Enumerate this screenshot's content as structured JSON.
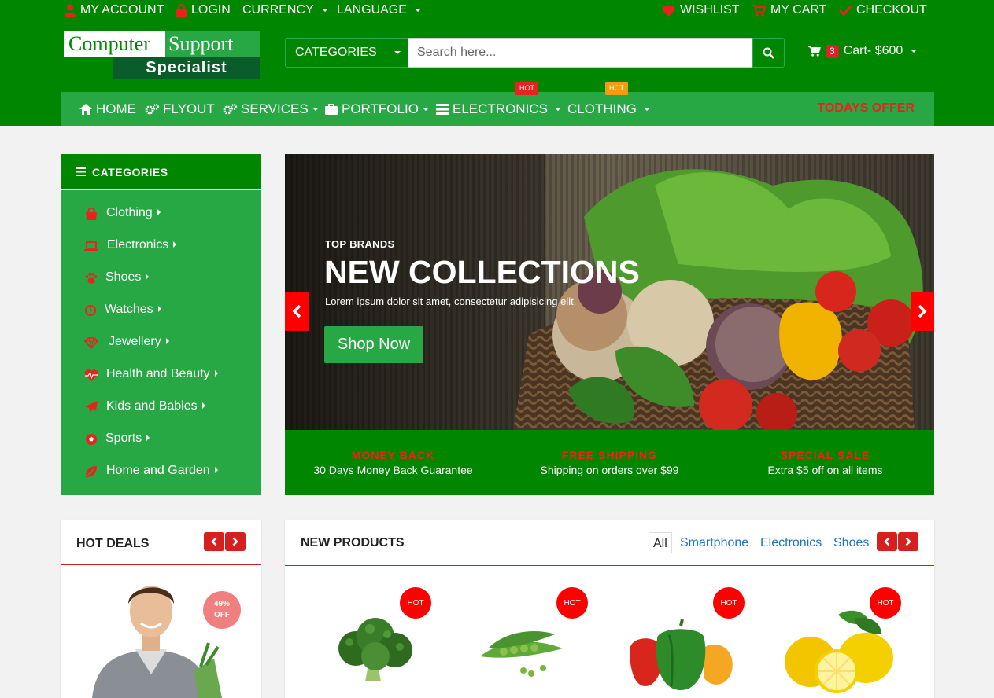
{
  "topbar": {
    "my_account": "MY ACCOUNT",
    "login": "LOGIN",
    "currency": "CURRENCY",
    "language": "LANGUAGE",
    "wishlist": "WISHLIST",
    "my_cart": "MY CART",
    "checkout": "CHECKOUT"
  },
  "logo": {
    "word1": "Computer",
    "word2": "Support",
    "word3": "Specialist"
  },
  "search": {
    "category_label": "CATEGORIES",
    "placeholder": "Search here..."
  },
  "cart": {
    "count": "3",
    "label": "Cart- $600"
  },
  "nav": {
    "items": [
      {
        "label": "HOME",
        "icon": "home-icon"
      },
      {
        "label": "FLYOUT",
        "icon": "gears-icon"
      },
      {
        "label": "SERVICES",
        "icon": "gears-icon"
      },
      {
        "label": "PORTFOLIO",
        "icon": "briefcase-icon"
      },
      {
        "label": "ELECTRONICS",
        "icon": "list-icon",
        "badge": "HOT"
      },
      {
        "label": "CLOTHING",
        "badge": "HOT"
      }
    ],
    "offer": "TODAYS OFFER"
  },
  "sidebar": {
    "title": "CATEGORIES",
    "items": [
      {
        "label": "Clothing",
        "icon": "bag-icon"
      },
      {
        "label": "Electronics",
        "icon": "laptop-icon"
      },
      {
        "label": "Shoes",
        "icon": "paw-icon"
      },
      {
        "label": "Watches",
        "icon": "clock-icon"
      },
      {
        "label": "Jewellery",
        "icon": "diamond-icon"
      },
      {
        "label": "Health and Beauty",
        "icon": "heartbeat-icon"
      },
      {
        "label": "Kids and Babies",
        "icon": "paper-plane-icon"
      },
      {
        "label": "Sports",
        "icon": "soccer-ball-icon"
      },
      {
        "label": "Home and Garden",
        "icon": "leaf-icon"
      }
    ]
  },
  "hero": {
    "kicker": "TOP BRANDS",
    "title": "NEW COLLECTIONS",
    "subtitle": "Lorem ipsum dolor sit amet, consectetur adipisicing elit.",
    "cta": "Shop Now"
  },
  "features": [
    {
      "title": "MONEY BACK",
      "sub": "30 Days Money Back Guarantee"
    },
    {
      "title": "FREE SHIPPING",
      "sub": "Shipping on orders over $99"
    },
    {
      "title": "SPECIAL SALE",
      "sub": "Extra $5 off on all items"
    }
  ],
  "hot_deals": {
    "title": "HOT DEALS",
    "discount_line1": "49%",
    "discount_line2": "OFF"
  },
  "new_products": {
    "title": "NEW PRODUCTS",
    "tabs": [
      "All",
      "Smartphone",
      "Electronics",
      "Shoes"
    ],
    "badge": "HOT",
    "items": [
      "broccoli",
      "green peas",
      "bell peppers",
      "lemons"
    ]
  },
  "colors": {
    "header": "#018601",
    "nav": "#28a745",
    "accent_red": "#ff0000",
    "link_blue": "#1e73be"
  }
}
